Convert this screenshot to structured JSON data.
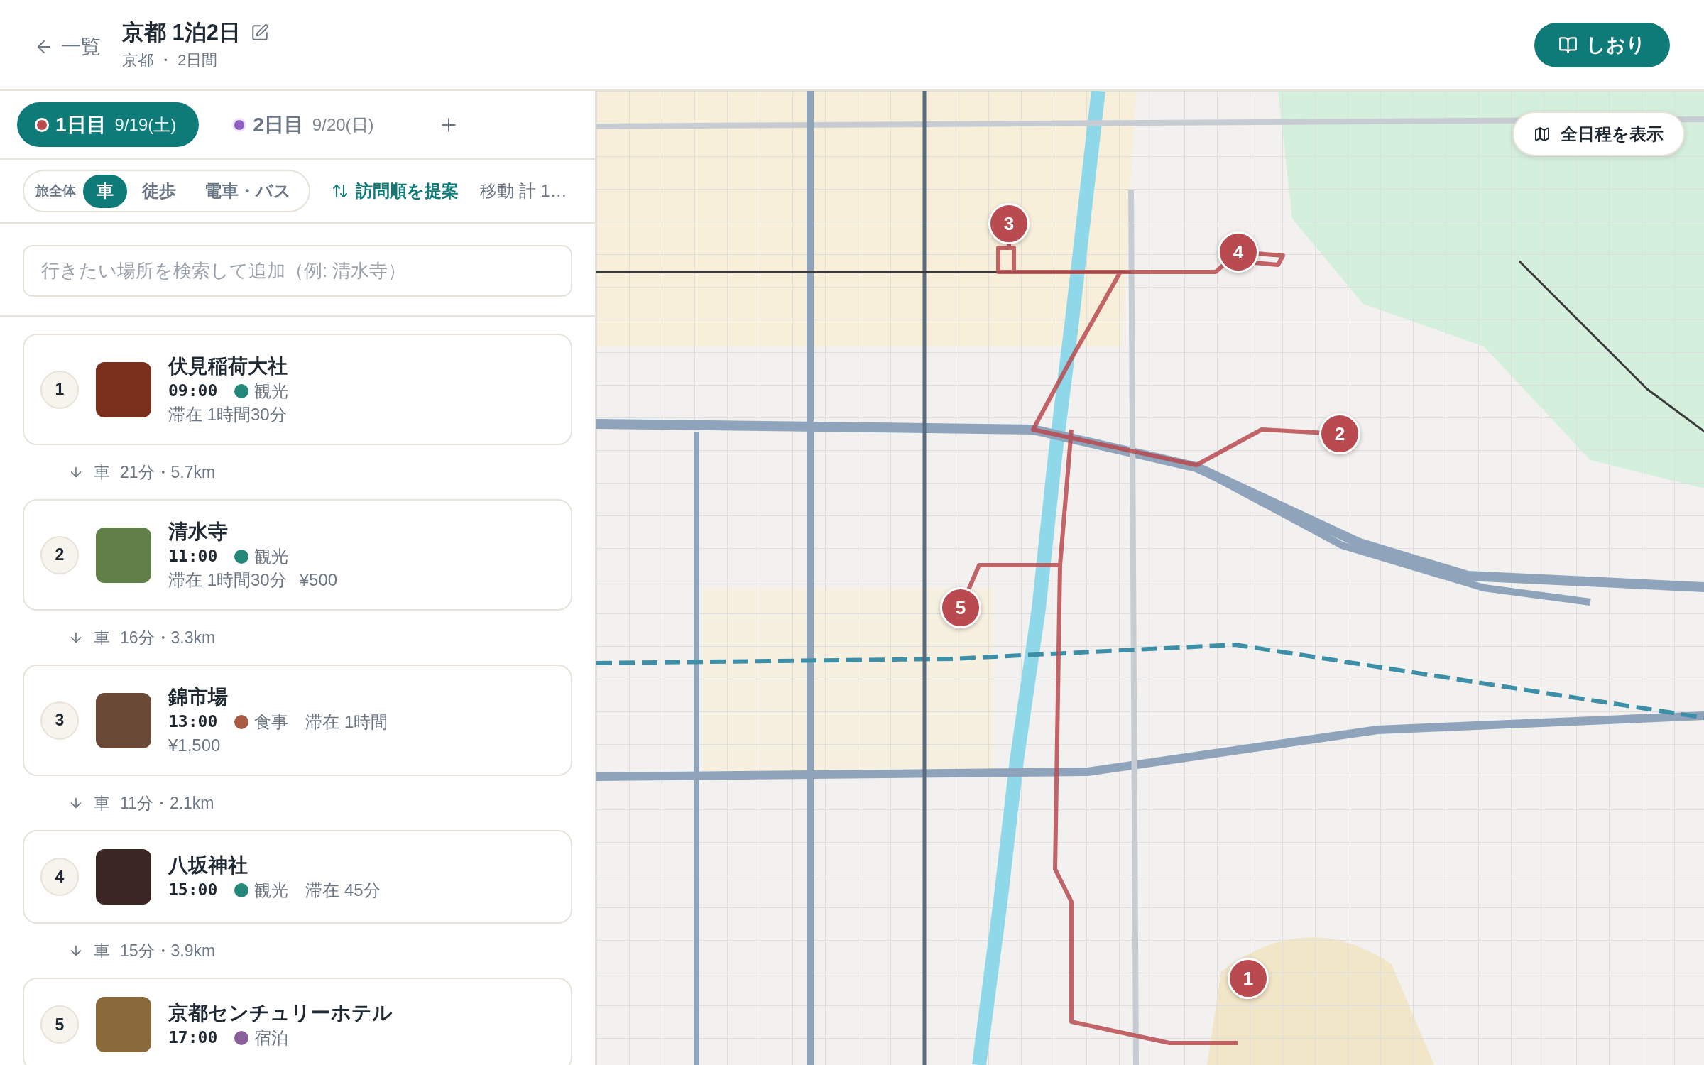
{
  "header": {
    "back": "一覧",
    "title": "京都 1泊2日",
    "subtitle": "京都 ・ 2日間",
    "primary_button": "しおり"
  },
  "days": [
    {
      "label": "1日目",
      "date": "9/19(土)",
      "color": "#b94a4f",
      "selected": true
    },
    {
      "label": "2日目",
      "date": "9/20(日)",
      "color": "#8e5fc0",
      "selected": false
    }
  ],
  "transport": {
    "scope_label": "旅全体",
    "modes": [
      {
        "label": "車",
        "selected": true
      },
      {
        "label": "徒歩",
        "selected": false
      },
      {
        "label": "電車・バス",
        "selected": false
      }
    ],
    "suggest_button": "訪問順を提案",
    "total": "移動 計 1…"
  },
  "search": {
    "placeholder": "行きたい場所を検索して追加（例: 清水寺）"
  },
  "itinerary": [
    {
      "kind": "stop",
      "number": "1",
      "name": "伏見稲荷大社",
      "time": "09:00",
      "category": {
        "label": "観光",
        "color": "#23877a"
      },
      "notes": [
        "滞在 1時間30分"
      ]
    },
    {
      "kind": "transit",
      "mode": "車",
      "detail": "21分・5.7km"
    },
    {
      "kind": "stop",
      "number": "2",
      "name": "清水寺",
      "time": "11:00",
      "category": {
        "label": "観光",
        "color": "#23877a"
      },
      "notes": [
        "滞在 1時間30分",
        "¥500"
      ]
    },
    {
      "kind": "transit",
      "mode": "車",
      "detail": "16分・3.3km"
    },
    {
      "kind": "stop",
      "number": "3",
      "name": "錦市場",
      "time": "13:00",
      "category": {
        "label": "食事",
        "color": "#a85a43"
      },
      "inline_notes": [
        "滞在 1時間"
      ],
      "notes": [
        "¥1,500"
      ]
    },
    {
      "kind": "transit",
      "mode": "車",
      "detail": "11分・2.1km"
    },
    {
      "kind": "stop",
      "number": "4",
      "name": "八坂神社",
      "time": "15:00",
      "category": {
        "label": "観光",
        "color": "#23877a"
      },
      "inline_notes": [
        "滞在 45分"
      ]
    },
    {
      "kind": "transit",
      "mode": "車",
      "detail": "15分・3.9km"
    },
    {
      "kind": "stop",
      "number": "5",
      "name": "京都センチュリーホテル",
      "time": "17:00",
      "category": {
        "label": "宿泊",
        "color": "#8a5f9c"
      }
    }
  ],
  "map": {
    "show_all_button": "全日程を表示",
    "markers": [
      {
        "number": "1"
      },
      {
        "number": "2"
      },
      {
        "number": "3"
      },
      {
        "number": "4"
      },
      {
        "number": "5"
      }
    ]
  }
}
